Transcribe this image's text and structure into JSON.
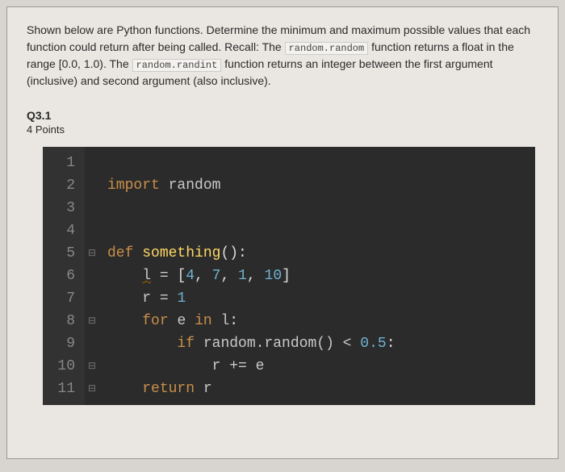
{
  "instructions": {
    "text_before_code1": "Shown below are Python functions. Determine the minimum and maximum possible values that each function could return after being called. Recall: The ",
    "code1": "random.random",
    "text_mid1": " function returns a float in the range [0.0, 1.0). The ",
    "code2": "random.randint",
    "text_after": " function returns an integer between the first argument (inclusive) and second argument (also inclusive)."
  },
  "question": {
    "number": "Q3.1",
    "points": "4 Points"
  },
  "code": {
    "line_numbers": [
      "1",
      "2",
      "3",
      "4",
      "5",
      "6",
      "7",
      "8",
      "9",
      "10",
      "11"
    ],
    "fold_markers": {
      "5": "⊟",
      "8": "⊟",
      "10": "⊟",
      "11": "⊟"
    },
    "tokens": {
      "import_kw": "import",
      "random_mod": "random",
      "def_kw": "def",
      "fn_name": "something",
      "parens": "():",
      "l_var": "l",
      "eq": " = ",
      "list_literal": "[4, 7, 1, 10]",
      "r_var": "r",
      "one": "1",
      "for_kw": "for",
      "e_var": "e",
      "in_kw": "in",
      "colon": ":",
      "if_kw": "if",
      "random_call": "random.random()",
      "lt": " < ",
      "half": "0.5",
      "plus_eq": " += ",
      "return_kw": "return"
    }
  }
}
